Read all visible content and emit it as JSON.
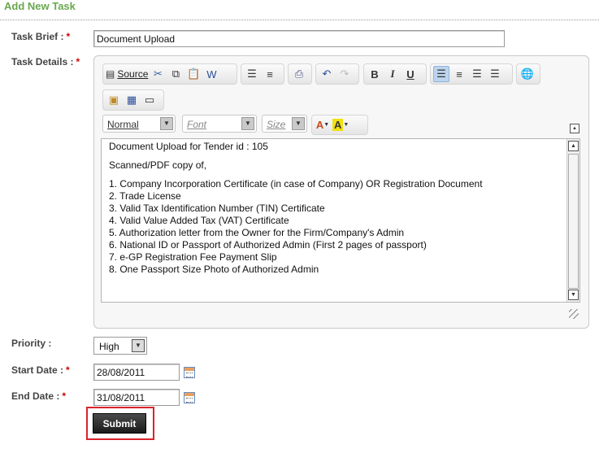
{
  "header": {
    "title": "Add New Task"
  },
  "form": {
    "task_brief": {
      "label": "Task Brief :",
      "required_mark": "*",
      "value": "Document Upload"
    },
    "task_details": {
      "label": "Task Details :",
      "required_mark": "*"
    },
    "priority": {
      "label": "Priority :",
      "value": "High"
    },
    "start_date": {
      "label": "Start Date :",
      "required_mark": "*",
      "value": "28/08/2011"
    },
    "end_date": {
      "label": "End Date :",
      "required_mark": "*",
      "value": "31/08/2011"
    },
    "submit_label": "Submit"
  },
  "editor": {
    "toolbar": {
      "source_label": "Source",
      "format_combo": "Normal",
      "font_combo": "Font",
      "size_combo": "Size",
      "icons": [
        "source-icon",
        "cut-icon",
        "copy-icon",
        "paste-icon",
        "paste-word-icon",
        "numbered-list-icon",
        "bulleted-list-icon",
        "print-icon",
        "undo-icon",
        "redo-icon",
        "bold-icon",
        "italic-icon",
        "underline-icon",
        "align-left-icon",
        "align-center-icon",
        "align-right-icon",
        "justify-icon",
        "link-icon",
        "image-icon",
        "table-icon",
        "horizontal-rule-icon",
        "text-color-icon",
        "background-color-icon"
      ],
      "bold_glyph": "B",
      "italic_glyph": "I",
      "underline_glyph": "U",
      "text_color_glyph": "A",
      "bg_color_glyph": "A"
    },
    "content": {
      "line1": "Document Upload for Tender id : 105",
      "line2": "Scanned/PDF copy of,",
      "items": [
        "1. Company Incorporation Certificate (in case of Company) OR Registration Document",
        "2. Trade License",
        "3. Valid Tax Identification Number (TIN) Certificate",
        "4. Valid Value Added Tax (VAT) Certificate",
        "5. Authorization letter from the Owner for the Firm/Company's Admin",
        "6. National ID or Passport of Authorized Admin (First 2 pages of passport)",
        "7. e-GP Registration Fee Payment Slip",
        "8. One Passport Size Photo of Authorized Admin"
      ]
    }
  },
  "colors": {
    "title_green": "#6aa84f",
    "required_red": "#cc0000",
    "highlight_red": "#d9232d"
  }
}
